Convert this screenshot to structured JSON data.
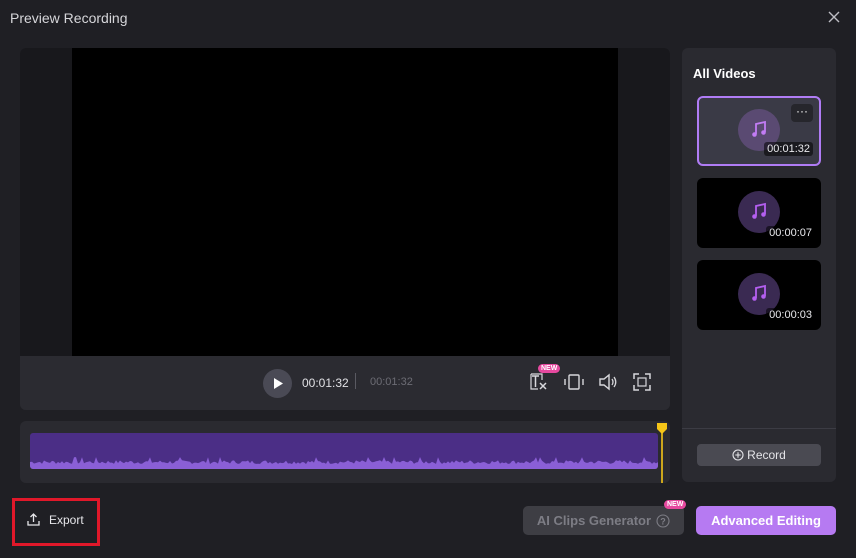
{
  "window": {
    "title": "Preview Recording"
  },
  "player": {
    "current_time": "00:01:32",
    "total_time": "00:01:32",
    "subtitle_badge": "NEW"
  },
  "sidebar": {
    "title": "All Videos",
    "videos": [
      {
        "duration": "00:01:32",
        "selected": true,
        "more_label": "···"
      },
      {
        "duration": "00:00:07",
        "selected": false
      },
      {
        "duration": "00:00:03",
        "selected": false
      }
    ],
    "record_label": "Record"
  },
  "footer": {
    "export_label": "Export",
    "ai_clips_label": "AI Clips Generator",
    "ai_clips_badge": "NEW",
    "advanced_label": "Advanced Editing"
  },
  "colors": {
    "accent": "#b67af2",
    "waveform": "#4b2e86",
    "playhead": "#f5c518",
    "new_badge": "#e6499f",
    "highlight": "#e0182a"
  }
}
